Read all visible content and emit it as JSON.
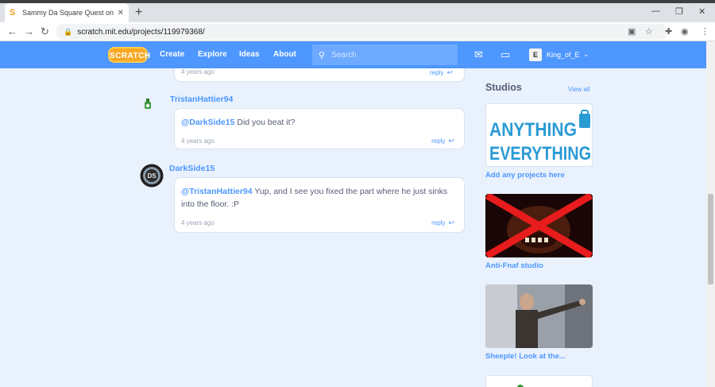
{
  "browser": {
    "tab_title": "Sammy Da Square Quest on Scr",
    "new_tab": "+",
    "url": "scratch.mit.edu/projects/119979368/"
  },
  "nav": {
    "logo": "SCRATCH",
    "links": [
      "Create",
      "Explore",
      "Ideas",
      "About"
    ],
    "search_placeholder": "Search",
    "username": "King_of_E"
  },
  "comments": [
    {
      "time": "4 years ago",
      "reply": "reply"
    },
    {
      "author": "TristanHattier94",
      "mention": "@DarkSide15",
      "text": " Did you beat it?",
      "time": "4 years ago",
      "reply": "reply"
    },
    {
      "author": "DarkSide15",
      "mention": "@TristanHattier94",
      "text": " Yup, and I see you fixed the part where he just sinks into the floor. :P",
      "time": "4 years ago",
      "reply": "reply"
    }
  ],
  "studios": {
    "title": "Studios",
    "view_all": "View all",
    "items": [
      {
        "name": "Add any projects here",
        "thumb_text_1": "ANYTHING",
        "thumb_text_2": "EVERYTHING"
      },
      {
        "name": "Anti-Fnaf studio"
      },
      {
        "name": "Sheeple! Look at the..."
      }
    ]
  },
  "colors": {
    "accent": "#4d97ff",
    "text": "#575e75",
    "background": "#e9f1fc"
  }
}
